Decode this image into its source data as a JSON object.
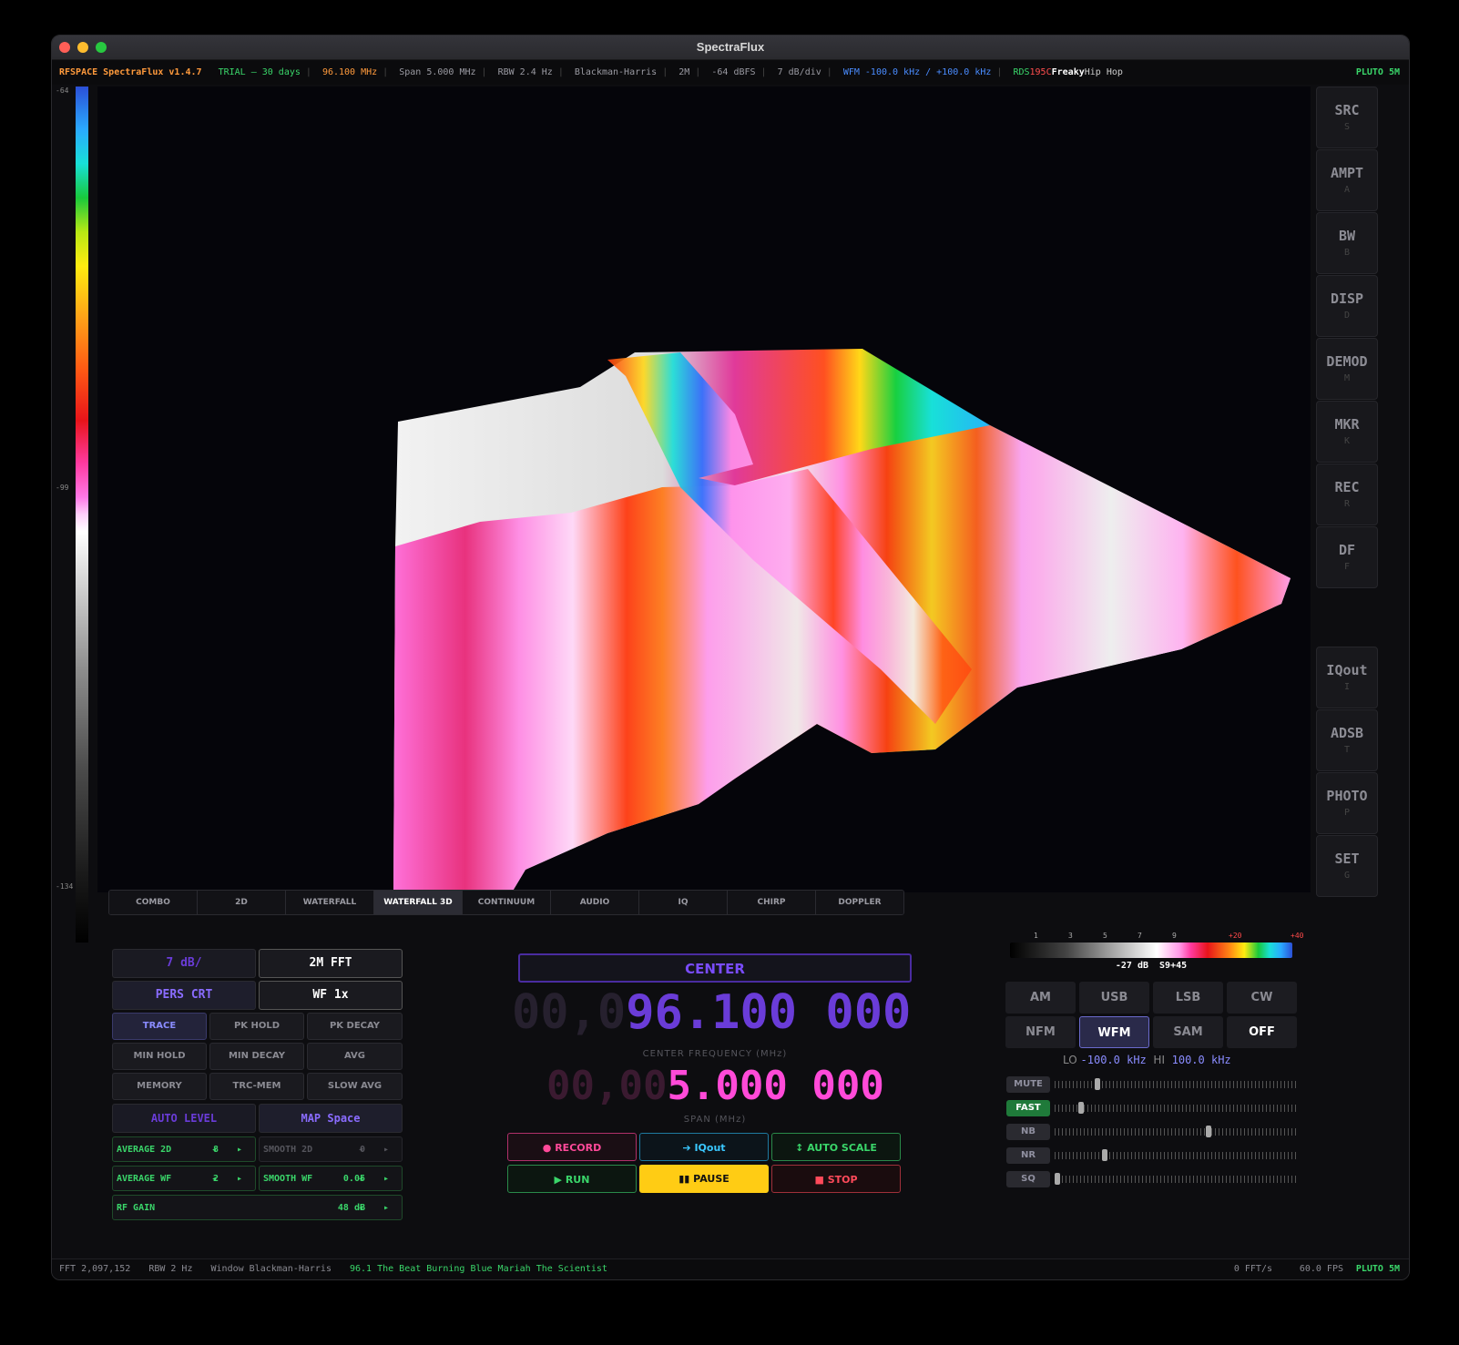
{
  "window": {
    "title": "SpectraFlux"
  },
  "status": {
    "app": "RFSPACE SpectraFlux v1.4.7",
    "trial": "TRIAL — 30 days",
    "freq": "96.100 MHz",
    "span": "Span 5.000 MHz",
    "rbw": "RBW 2.4 Hz",
    "window": "Blackman-Harris",
    "fft": "2M",
    "ref": "-64 dBFS",
    "scale": "7 dB/div",
    "demod": "WFM -100.0 kHz / +100.0 kHz",
    "rds_label": "RDS",
    "rds_pi": "195C",
    "rds_ps": "Freaky",
    "rds_genre": "Hip Hop",
    "device": "PLUTO 5M"
  },
  "colorbar": {
    "top": "-64",
    "mid": "-99",
    "bottom": "-134"
  },
  "side_buttons": [
    {
      "label": "SRC",
      "key": "S"
    },
    {
      "label": "AMPT",
      "key": "A"
    },
    {
      "label": "BW",
      "key": "B"
    },
    {
      "label": "DISP",
      "key": "D"
    },
    {
      "label": "DEMOD",
      "key": "M"
    },
    {
      "label": "MKR",
      "key": "K"
    },
    {
      "label": "REC",
      "key": "R"
    },
    {
      "label": "DF",
      "key": "F"
    },
    {
      "label": "IQout",
      "key": "I"
    },
    {
      "label": "ADSB",
      "key": "T"
    },
    {
      "label": "PHOTO",
      "key": "P"
    },
    {
      "label": "SET",
      "key": "G"
    }
  ],
  "tabs": [
    "COMBO",
    "2D",
    "WATERFALL",
    "WATERFALL 3D",
    "CONTINUUM",
    "AUDIO",
    "IQ",
    "CHIRP",
    "DOPPLER"
  ],
  "left_panel": {
    "db_div": "7 dB/",
    "fft": "2M FFT",
    "pers": "PERS CRT",
    "wf": "WF 1x",
    "trace_modes": [
      "TRACE",
      "PK HOLD",
      "PK DECAY",
      "MIN HOLD",
      "MIN DECAY",
      "AVG",
      "MEMORY",
      "TRC-MEM",
      "SLOW AVG"
    ],
    "auto_level": "AUTO LEVEL",
    "map": "MAP Space",
    "avg2d": {
      "name": "AVERAGE 2D",
      "value": "8"
    },
    "smooth2d": {
      "name": "SMOOTH 2D",
      "value": "0"
    },
    "avgwf": {
      "name": "AVERAGE WF",
      "value": "2"
    },
    "smoothwf": {
      "name": "SMOOTH WF",
      "value": "0.05"
    },
    "rfgain": {
      "name": "RF GAIN",
      "value": "48 dB"
    },
    "arrows": "◂ ▸"
  },
  "center": {
    "mode_label": "CENTER",
    "freq_dim": "00,0",
    "freq_main": "96.100 000",
    "freq_caption": "CENTER FREQUENCY (MHz)",
    "span_dim": "00,00",
    "span_main": "5.000 000",
    "span_caption": "SPAN (MHz)",
    "record": "● RECORD",
    "iqout": "➔ IQout",
    "autoscale": "↕ AUTO SCALE",
    "run": "▶ RUN",
    "pause": "▮▮ PAUSE",
    "stop": "■ STOP"
  },
  "smeter": {
    "ticks": [
      "1",
      "3",
      "5",
      "7",
      "9",
      "+20",
      "+40"
    ],
    "db": "-27 dB",
    "s": "S9+45"
  },
  "modes": [
    "AM",
    "USB",
    "LSB",
    "CW",
    "NFM",
    "WFM",
    "SAM",
    "OFF"
  ],
  "filter": {
    "lo_label": "LO",
    "lo": "-100.0 kHz",
    "hi_label": "HI",
    "hi": "100.0 kHz"
  },
  "sliders": [
    {
      "label": "MUTE",
      "level": 0.17
    },
    {
      "label": "FAST",
      "level": 0.1
    },
    {
      "label": "NB",
      "level": 0.64
    },
    {
      "label": "NR",
      "level": 0.2
    },
    {
      "label": "SQ",
      "level": 0.0
    }
  ],
  "bottom": {
    "fft": "FFT 2,097,152",
    "rbw": "RBW 2 Hz",
    "window": "Window Blackman-Harris",
    "rds": "96.1 The Beat Burning Blue Mariah The Scientist",
    "ffts": "0 FFT/s",
    "fps": "60.0 FPS",
    "device": "PLUTO 5M"
  }
}
